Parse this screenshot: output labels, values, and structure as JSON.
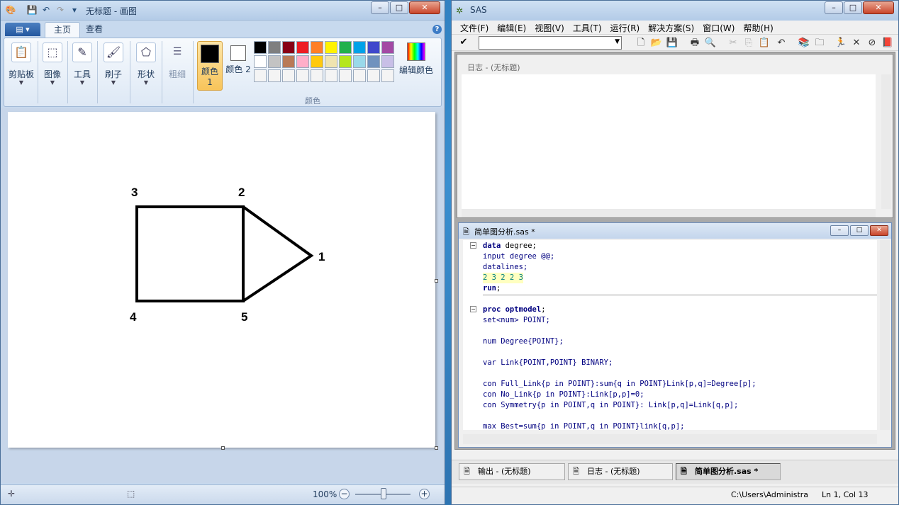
{
  "paint": {
    "title": "无标题 - 画图",
    "tabs": {
      "home": "主页",
      "view": "查看"
    },
    "groups": {
      "clipboard": "剪贴板",
      "image": "图像",
      "tools": "工具",
      "brushes": "刷子",
      "shapes": "形状",
      "size": "粗细",
      "color1": "颜色 1",
      "color2": "颜色 2",
      "colors": "颜色",
      "edit_colors": "编辑颜色"
    },
    "palette": [
      "#000000",
      "#7f7f7f",
      "#880015",
      "#ed1c24",
      "#ff7f27",
      "#fff200",
      "#22b14c",
      "#00a2e8",
      "#3f48cc",
      "#a349a4",
      "#ffffff",
      "#c3c3c3",
      "#b97a57",
      "#ffaec9",
      "#ffc90e",
      "#efe4b0",
      "#b5e61d",
      "#99d9ea",
      "#7092be",
      "#c8bfe7"
    ],
    "color1_value": "#000000",
    "color2_value": "#ffffff",
    "drawing_labels": {
      "n1": "1",
      "n2": "2",
      "n3": "3",
      "n4": "4",
      "n5": "5"
    },
    "zoom": "100%"
  },
  "sas": {
    "title": "SAS",
    "menu": [
      "文件(F)",
      "编辑(E)",
      "视图(V)",
      "工具(T)",
      "运行(R)",
      "解决方案(S)",
      "窗口(W)",
      "帮助(H)"
    ],
    "log_title": "日志 - (无标题)",
    "editor_title": "简单图分析.sas *",
    "code": {
      "l1": "degree;",
      "l2": "input degree @@;",
      "l3": "datalines;",
      "l4": "2 3 2 2 3",
      "l5": "run",
      "l6": "optmodel",
      "l7": "set<num> POINT;",
      "l8": "num Degree{POINT};",
      "l9": "var Link{POINT,POINT} BINARY;",
      "l10": "con Full_Link{p in POINT}:sum{q in POINT}Link[p,q]=Degree[p];",
      "l11": "con No_Link{p in POINT}:Link[p,p]=0;",
      "l12": "con Symmetry{p in POINT,q in POINT}: Link[p,q]=Link[q,p];",
      "l13": "max Best=sum{p in POINT,q in POINT}link[q,p];"
    },
    "tasks": {
      "output": "输出 - (无标题)",
      "log": "日志 - (无标题)",
      "editor": "简单图分析.sas *"
    },
    "status_path": "C:\\Users\\Administra",
    "status_pos": "Ln 1, Col 13"
  }
}
